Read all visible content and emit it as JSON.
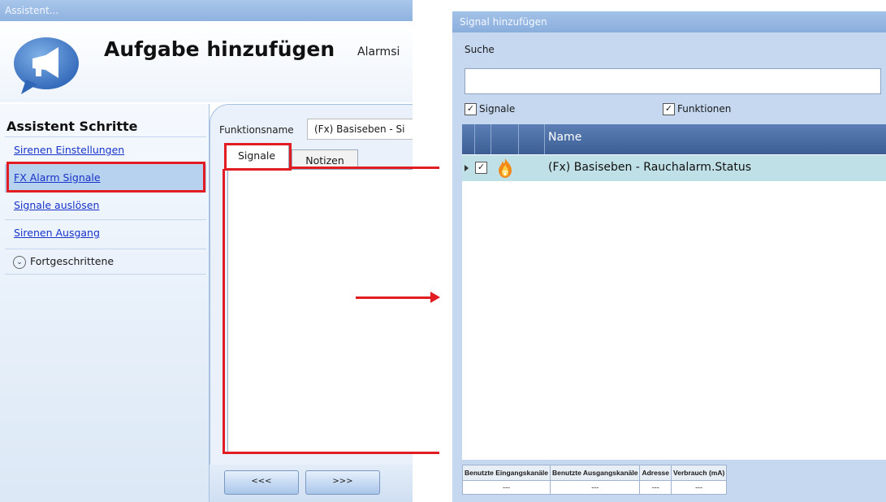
{
  "assistant": {
    "window_title": "Assistent...",
    "title": "Aufgabe hinzufügen",
    "subtitle": "Alarmsi",
    "steps_title": "Assistent Schritte",
    "steps": [
      {
        "label": "Sirenen Einstellungen"
      },
      {
        "label": "FX Alarm Signale"
      },
      {
        "label": "Signale auslösen"
      },
      {
        "label": "Sirenen Ausgang"
      }
    ],
    "advanced_label": "Fortgeschrittene",
    "function_name_label": "Funktionsname",
    "function_name_value": "(Fx) Basiseben - Si",
    "tabs": [
      {
        "label": "Signale"
      },
      {
        "label": "Notizen"
      }
    ],
    "back_button": "<<<",
    "next_button": ">>>"
  },
  "dialog": {
    "window_title": "Signal hinzufügen",
    "search_label": "Suche",
    "search_value": "",
    "filters": [
      {
        "label": "Signale",
        "checked": true
      },
      {
        "label": "Funktionen",
        "checked": true
      }
    ],
    "grid": {
      "columns": [
        "Name"
      ],
      "rows": [
        {
          "checked": true,
          "icon": "fire-alarm-icon",
          "name": "(Fx) Basiseben - Rauchalarm.Status"
        }
      ]
    },
    "stats": {
      "headers": [
        "Benutzte Eingangskanäle",
        "Benutzte Ausgangskanäle",
        "Adresse",
        "Verbrauch (mA)"
      ],
      "values": [
        "---",
        "---",
        "---",
        "---"
      ]
    }
  },
  "colors": {
    "highlight_red": "#e11d23",
    "link_blue": "#1733c9",
    "selected_row": "#bfe0e6",
    "grid_header": "#3c5e95"
  }
}
